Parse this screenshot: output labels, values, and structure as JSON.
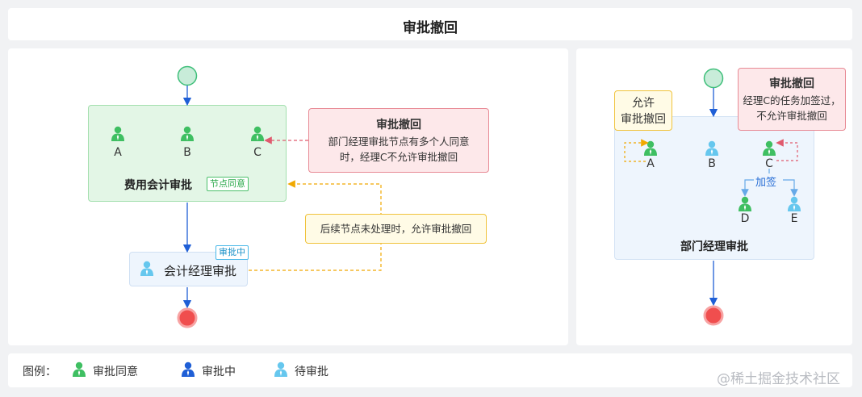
{
  "title": "审批撤回",
  "left": {
    "expense_node": {
      "label": "费用会计审批",
      "tag": "节点同意",
      "approvers": [
        "A",
        "B",
        "C"
      ]
    },
    "accountant_manager_node": {
      "label": "会计经理审批",
      "tag": "审批中"
    },
    "note_pink": {
      "title": "审批撤回",
      "line1": "部门经理审批节点有多个人同意",
      "line2": "时，经理C不允许审批撤回"
    },
    "note_yellow": {
      "text": "后续节点未处理时，允许审批撤回"
    }
  },
  "right": {
    "dept_node": {
      "label": "部门经理审批",
      "approvers": [
        "A",
        "B",
        "C"
      ],
      "added_signers": [
        "D",
        "E"
      ],
      "add_sign_label": "加签"
    },
    "note_yellow": {
      "line1": "允许",
      "line2": "审批撤回"
    },
    "note_pink": {
      "title": "审批撤回",
      "line1": "经理C的任务加签过，",
      "line2": "不允许审批撤回"
    }
  },
  "legend": {
    "title": "图例：",
    "items": [
      {
        "label": "审批同意",
        "color": "#3fbf62"
      },
      {
        "label": "审批中",
        "color": "#1f5fd6"
      },
      {
        "label": "待审批",
        "color": "#66c7ee"
      }
    ]
  },
  "watermark": "@稀土掘金技术社区",
  "colors": {
    "green": "#3fbf62",
    "blue": "#1f5fd6",
    "light_blue": "#66c7ee",
    "pink_border": "#e88a95",
    "yellow_border": "#f0c33c",
    "start_fill": "#c8ecd9",
    "end_fill": "#f04e4e"
  }
}
